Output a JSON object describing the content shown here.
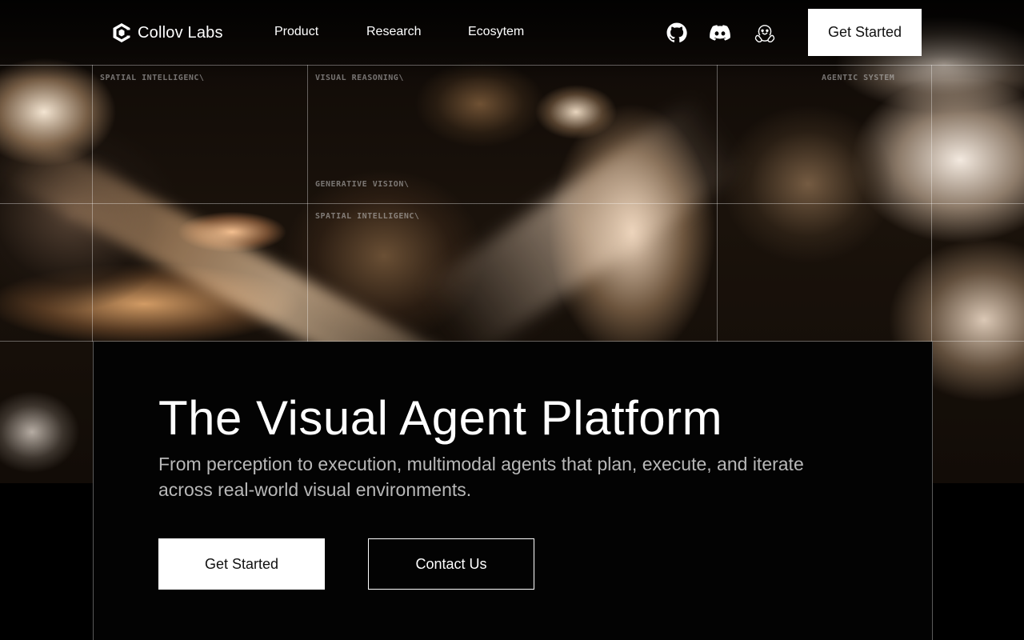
{
  "brand": {
    "name": "Collov Labs",
    "logo_icon": "collov-logo-icon"
  },
  "nav": {
    "links": [
      {
        "label": "Product"
      },
      {
        "label": "Research"
      },
      {
        "label": "Ecosytem"
      }
    ],
    "icons": [
      "github-icon",
      "discord-icon",
      "huggingface-icon"
    ],
    "cta_label": "Get Started"
  },
  "grid_labels": [
    "SPATIAL INTELLIGENC\\",
    "VISUAL REASONING\\",
    "AGENTIC SYSTEM",
    "GENERATIVE VISION\\",
    "SPATIAL INTELLIGENC\\"
  ],
  "hero": {
    "title": "The Visual Agent Platform",
    "subtitle": "From perception to execution, multimodal agents that plan, execute, and iterate across real-world visual environments.",
    "primary_label": "Get Started",
    "secondary_label": "Contact Us"
  },
  "colors": {
    "background": "#000000",
    "text_primary": "#ffffff",
    "text_secondary": "#b8b8b8",
    "button_bg": "#ffffff",
    "button_text": "#111111"
  }
}
